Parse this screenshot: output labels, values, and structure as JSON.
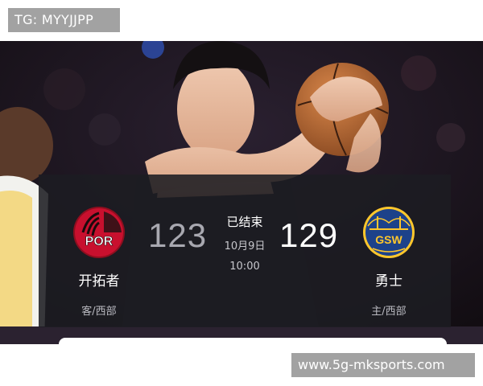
{
  "watermarks": {
    "top": "TG: MYYJJPP",
    "bottom": "www.5g-mksports.com"
  },
  "game": {
    "away": {
      "name": "开拓者",
      "side": "客/西部",
      "score": "123",
      "logo_text": "POR",
      "logo_color": "#c8102e"
    },
    "home": {
      "name": "勇士",
      "side": "主/西部",
      "score": "129",
      "logo_text": "GSW",
      "logo_color": "#1d428a",
      "logo_accent": "#ffc72c"
    },
    "status": "已结束",
    "date": "10月9日",
    "time": "10:00"
  },
  "colors": {
    "panel": "#1c1c22",
    "watermark_bg": "#a2a2a2"
  }
}
